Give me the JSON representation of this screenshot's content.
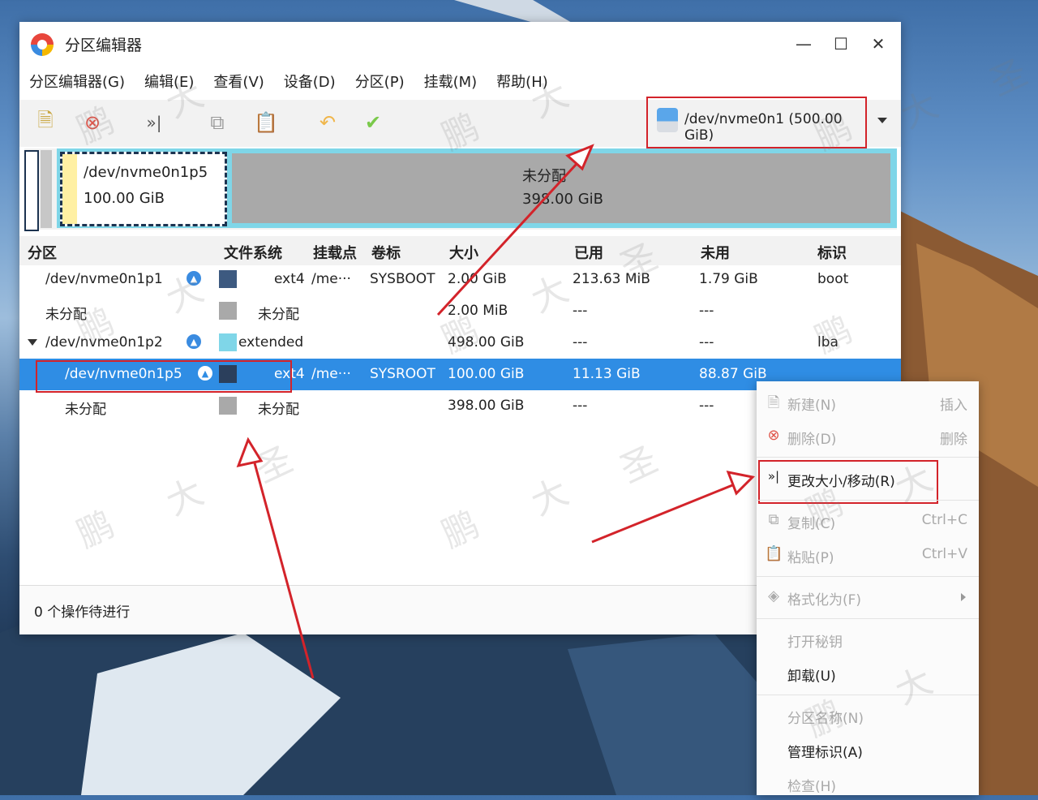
{
  "window": {
    "title": "分区编辑器"
  },
  "menu": [
    "分区编辑器(G)",
    "编辑(E)",
    "查看(V)",
    "设备(D)",
    "分区(P)",
    "挂载(M)",
    "帮助(H)"
  ],
  "toolbar": {
    "icons": [
      "new-icon",
      "delete-icon",
      "resize-icon",
      "copy-icon",
      "paste-icon",
      "undo-icon",
      "apply-icon"
    ],
    "device": "/dev/nvme0n1 (500.00 GiB)"
  },
  "diskmap": {
    "partition": {
      "name": "/dev/nvme0n1p5",
      "size": "100.00 GiB"
    },
    "unallocated": {
      "name": "未分配",
      "size": "398.00 GiB"
    }
  },
  "table": {
    "headers": [
      "分区",
      "文件系统",
      "挂载点",
      "卷标",
      "大小",
      "已用",
      "未用",
      "标识"
    ],
    "rows": [
      {
        "partition": "/dev/nvme0n1p1",
        "fs": "ext4",
        "mount": "/me···",
        "label": "SYSBOOT",
        "size": "2.00 GiB",
        "used": "213.63 MiB",
        "unused": "1.79 GiB",
        "flags": "boot",
        "color": "#3d5a80"
      },
      {
        "partition": "未分配",
        "fs": "未分配",
        "mount": "",
        "label": "",
        "size": "2.00 MiB",
        "used": "---",
        "unused": "---",
        "flags": "",
        "color": "#a9a9a9"
      },
      {
        "partition": "/dev/nvme0n1p2",
        "fs": "extended",
        "mount": "",
        "label": "",
        "size": "498.00 GiB",
        "used": "---",
        "unused": "---",
        "flags": "lba",
        "color": "#7fd6e8"
      },
      {
        "partition": "/dev/nvme0n1p5",
        "fs": "ext4",
        "mount": "/me···",
        "label": "SYSROOT",
        "size": "100.00 GiB",
        "used": "11.13 GiB",
        "unused": "88.87 GiB",
        "flags": "",
        "color": "#2b3f5c"
      },
      {
        "partition": "未分配",
        "fs": "未分配",
        "mount": "",
        "label": "",
        "size": "398.00 GiB",
        "used": "---",
        "unused": "---",
        "flags": "",
        "color": "#a9a9a9"
      }
    ]
  },
  "status": "0 个操作待进行",
  "context_menu": {
    "new": {
      "label": "新建(N)",
      "shortcut": "插入"
    },
    "delete": {
      "label": "删除(D)",
      "shortcut": "删除"
    },
    "resize": {
      "label": "更改大小/移动(R)"
    },
    "copy": {
      "label": "复制(C)",
      "shortcut": "Ctrl+C"
    },
    "paste": {
      "label": "粘贴(P)",
      "shortcut": "Ctrl+V"
    },
    "format": {
      "label": "格式化为(F)"
    },
    "open_key": {
      "label": "打开秘钥"
    },
    "unmount": {
      "label": "卸载(U)"
    },
    "name": {
      "label": "分区名称(N)"
    },
    "flags": {
      "label": "管理标识(A)"
    },
    "check": {
      "label": "检查(H)"
    }
  },
  "watermark": [
    "鹏",
    "大",
    "圣"
  ],
  "colors": {
    "selection": "#2f8de4",
    "annotation": "#d3232a",
    "extended": "#7fd6e8",
    "unallocated": "#a9a9a9"
  }
}
